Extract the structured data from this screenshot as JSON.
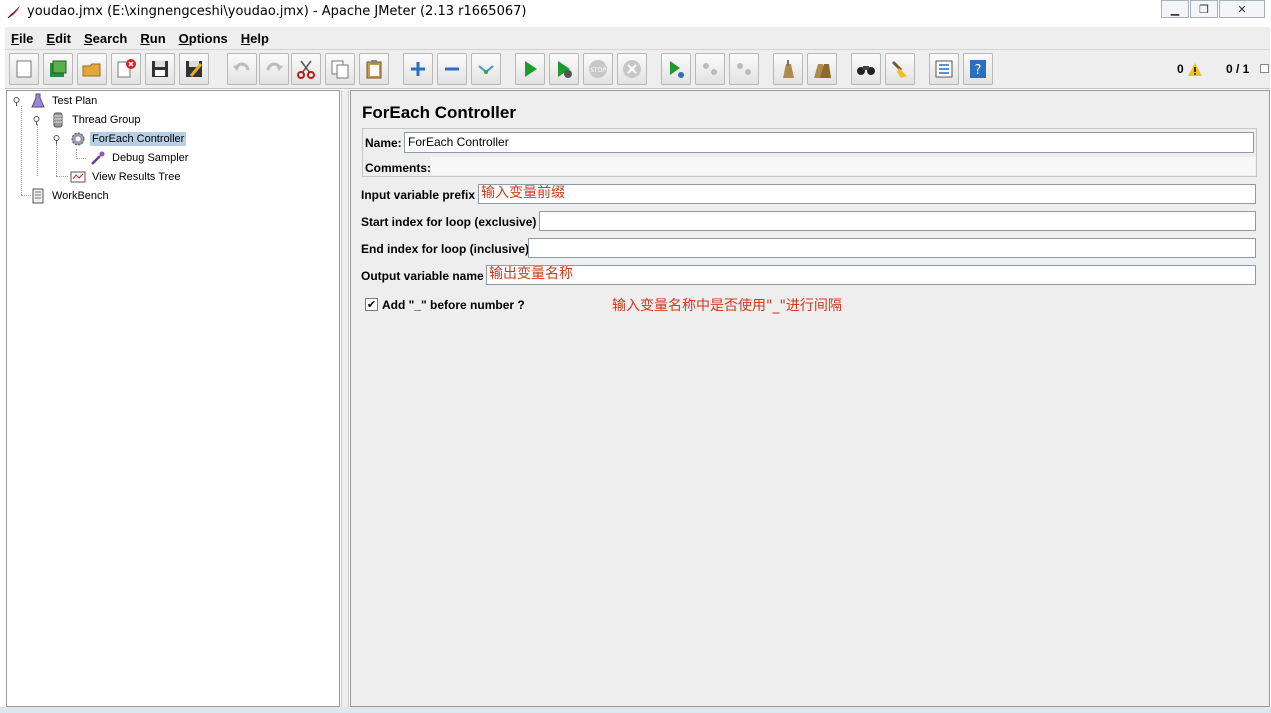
{
  "window": {
    "title": "youdao.jmx (E:\\xingnengceshi\\youdao.jmx) - Apache JMeter (2.13 r1665067)",
    "controls": [
      "minimize",
      "maximize",
      "close"
    ]
  },
  "menu": [
    "File",
    "Edit",
    "Search",
    "Run",
    "Options",
    "Help"
  ],
  "toolbar": {
    "buttons": [
      {
        "name": "new-icon"
      },
      {
        "name": "templates-icon"
      },
      {
        "name": "open-icon"
      },
      {
        "name": "close-file-icon"
      },
      {
        "name": "save-icon"
      },
      {
        "name": "save-as-icon"
      },
      {
        "name": "undo-icon"
      },
      {
        "name": "redo-icon"
      },
      {
        "name": "cut-icon"
      },
      {
        "name": "copy-icon"
      },
      {
        "name": "paste-icon"
      },
      {
        "name": "expand-icon"
      },
      {
        "name": "collapse-icon"
      },
      {
        "name": "toggle-icon"
      },
      {
        "name": "start-icon"
      },
      {
        "name": "start-no-pause-icon"
      },
      {
        "name": "stop-icon"
      },
      {
        "name": "shutdown-icon"
      },
      {
        "name": "remote-start-icon"
      },
      {
        "name": "remote-stop-icon"
      },
      {
        "name": "remote-exit-icon"
      },
      {
        "name": "clear-icon"
      },
      {
        "name": "clear-all-icon"
      },
      {
        "name": "search-icon"
      },
      {
        "name": "reset-search-icon"
      },
      {
        "name": "function-helper-icon"
      },
      {
        "name": "help-icon"
      }
    ],
    "warning_count": "0",
    "thread_count": "0 / 1"
  },
  "tree": {
    "nodes": [
      {
        "label": "Test Plan"
      },
      {
        "label": "Thread Group"
      },
      {
        "label": "ForEach Controller"
      },
      {
        "label": "Debug Sampler"
      },
      {
        "label": "View Results Tree"
      },
      {
        "label": "WorkBench"
      }
    ]
  },
  "panel": {
    "title": "ForEach Controller",
    "name_label": "Name:",
    "name_value": "ForEach Controller",
    "comments_label": "Comments:",
    "input_prefix_label": "Input variable prefix",
    "input_prefix_value": "输入变量前缀",
    "start_index_label": "Start index for loop (exclusive)",
    "start_index_value": "",
    "end_index_label": "End index for loop (inclusive)",
    "end_index_value": "",
    "output_name_label": "Output variable name",
    "output_name_value": "输出变量名称",
    "add_underscore_label": "Add \"_\" before number ?",
    "add_underscore_checked": true,
    "annotation": "输入变量名称中是否使用\"_\"进行间隔"
  },
  "colors": {
    "annotation_red": "#d23a1e",
    "selection": "#b8cfe5",
    "panel_bg": "#eeeeee"
  }
}
